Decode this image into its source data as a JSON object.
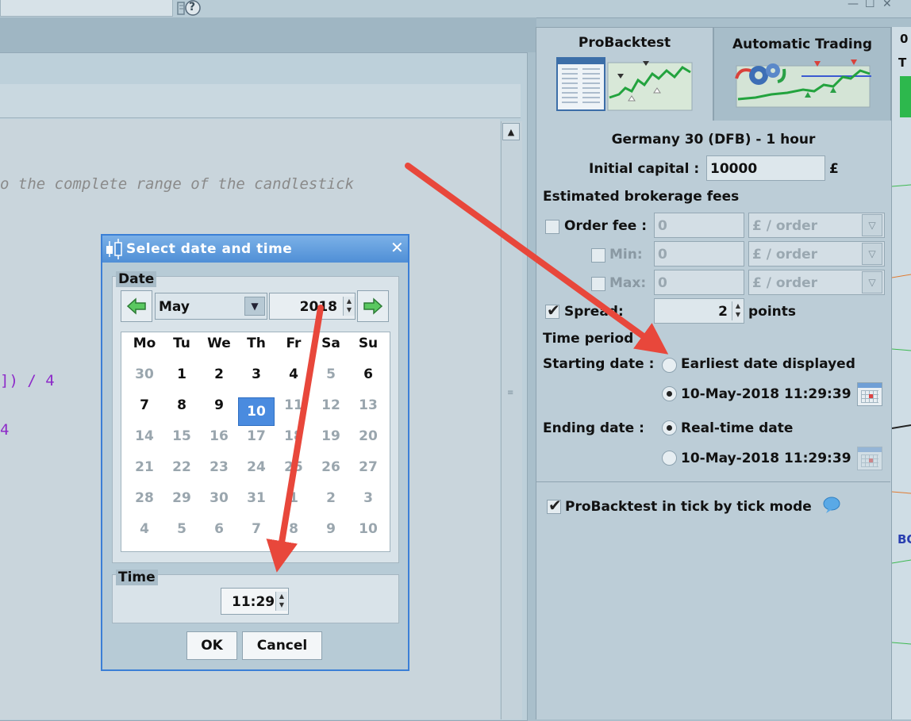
{
  "window": {
    "help_glyph": "?",
    "minimize_glyph": "—",
    "maximize_glyph": "☐",
    "close_glyph": "✕"
  },
  "editor": {
    "code_line_1": "o the complete range of the candlestick",
    "code_line_2": "]) / 4",
    "code_line_3": "4",
    "scroll_up_glyph": "▲",
    "scroll_grip_glyph": "≡"
  },
  "tabs": [
    {
      "label": "ProBacktest",
      "active": true
    },
    {
      "label": "Automatic Trading",
      "active": false
    }
  ],
  "right_panel": {
    "instrument_title": "Germany 30 (DFB) - 1 hour",
    "initial_capital_label": "Initial capital :",
    "initial_capital_value": "10000",
    "currency_symbol": "£",
    "fees_header": "Estimated brokerage fees",
    "order_fee": {
      "label": "Order fee :",
      "value": "0",
      "unit": "£ / order",
      "checked": false
    },
    "min_fee": {
      "label": "Min:",
      "value": "0",
      "unit": "£ / order",
      "checked": false
    },
    "max_fee": {
      "label": "Max:",
      "value": "0",
      "unit": "£ / order",
      "checked": false
    },
    "spread": {
      "label": "Spread:",
      "value": "2",
      "unit": "points",
      "checked": true
    },
    "time_period_header": "Time period",
    "starting_date_label": "Starting date :",
    "start_option_earliest": "Earliest date displayed",
    "start_option_date": "10-May-2018 11:29:39",
    "start_selected": "date",
    "ending_date_label": "Ending date :",
    "end_option_realtime": "Real-time date",
    "end_option_date": "10-May-2018 11:29:39",
    "end_selected": "realtime",
    "tick_mode_label": "ProBacktest in tick by tick mode",
    "tick_mode_checked": true
  },
  "edge_text": {
    "top": "0",
    "mid": "T",
    "bottom": "BO"
  },
  "dialog": {
    "title": "Select date and time",
    "close_glyph": "✕",
    "date_group_label": "Date",
    "month": "May",
    "year": "2018",
    "weekdays": [
      "Mo",
      "Tu",
      "We",
      "Th",
      "Fr",
      "Sa",
      "Su"
    ],
    "weeks": [
      [
        "30",
        "1",
        "2",
        "3",
        "4",
        "5",
        "6"
      ],
      [
        "7",
        "8",
        "9",
        "10",
        "11",
        "12",
        "13"
      ],
      [
        "14",
        "15",
        "16",
        "17",
        "18",
        "19",
        "20"
      ],
      [
        "21",
        "22",
        "23",
        "24",
        "25",
        "26",
        "27"
      ],
      [
        "28",
        "29",
        "30",
        "31",
        "1",
        "2",
        "3"
      ],
      [
        "4",
        "5",
        "6",
        "7",
        "8",
        "9",
        "10"
      ]
    ],
    "in_month": [
      [
        false,
        true,
        true,
        true,
        true,
        false,
        true
      ],
      [
        true,
        true,
        true,
        true,
        false,
        false,
        false
      ],
      [
        false,
        false,
        false,
        false,
        false,
        false,
        false
      ],
      [
        false,
        false,
        false,
        false,
        false,
        false,
        false
      ],
      [
        false,
        false,
        false,
        false,
        false,
        false,
        false
      ],
      [
        false,
        false,
        false,
        false,
        false,
        false,
        false
      ]
    ],
    "selected_day": "10",
    "time_group_label": "Time",
    "time": "11:29",
    "ok_label": "OK",
    "cancel_label": "Cancel"
  },
  "colors": {
    "accent_blue": "#4a8bdf",
    "annotation_arrow": "#e8473b",
    "chart_green": "#2db84d"
  }
}
